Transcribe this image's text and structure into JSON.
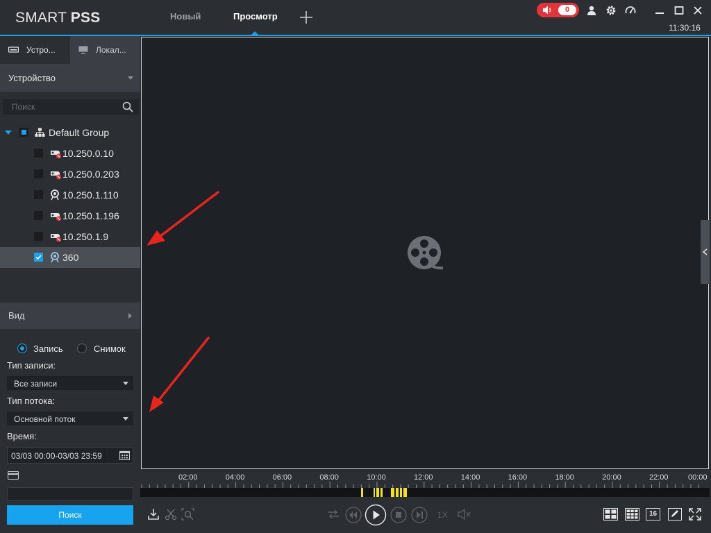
{
  "app": {
    "logo_light": "SMART ",
    "logo_bold": "PSS"
  },
  "topbar": {
    "tabs": [
      {
        "label": "Новый",
        "active": false
      },
      {
        "label": "Просмотр",
        "active": true
      }
    ],
    "alarm_count": "0",
    "clock": "11:30:16",
    "accent": "#1ea0e8",
    "alarm_color": "#e0353b"
  },
  "sidebar": {
    "tabs": [
      {
        "label": "Устро...",
        "icon": "device-icon",
        "active": true
      },
      {
        "label": "Локал...",
        "icon": "monitor-icon",
        "active": false
      }
    ],
    "device_header": "Устройство",
    "search_placeholder": "Поиск",
    "tree": {
      "group": "Default Group",
      "devices": [
        {
          "label": "10.250.0.10",
          "icon": "camera-offline-icon",
          "checked": false
        },
        {
          "label": "10.250.0.203",
          "icon": "camera-offline-icon",
          "checked": false
        },
        {
          "label": "10.250.1.110",
          "icon": "ipc-camera-icon",
          "checked": false
        },
        {
          "label": "10.250.1.196",
          "icon": "camera-offline-icon",
          "checked": false
        },
        {
          "label": "10.250.1.9",
          "icon": "camera-offline-icon",
          "checked": false
        },
        {
          "label": "360",
          "icon": "ipc-camera-icon",
          "checked": true,
          "selected": true
        }
      ]
    },
    "view_header": "Вид",
    "search_panel": {
      "radio_record": "Запись",
      "radio_snapshot": "Снимок",
      "record_type_label": "Тип записи:",
      "record_type_value": "Все записи",
      "stream_label": "Тип потока:",
      "stream_value": "Основной поток",
      "time_label": "Время:",
      "time_value": "03/03 00:00-03/03 23:59",
      "search_button": "Поиск"
    }
  },
  "timeline": {
    "hour_labels": [
      "02:00",
      "04:00",
      "06:00",
      "08:00",
      "10:00",
      "12:00",
      "14:00",
      "16:00",
      "18:00",
      "20:00",
      "22:00",
      "00:00"
    ],
    "recording_color": "#f2e21a"
  },
  "controls": {
    "speed": "1X",
    "grid_16_label": "16"
  }
}
